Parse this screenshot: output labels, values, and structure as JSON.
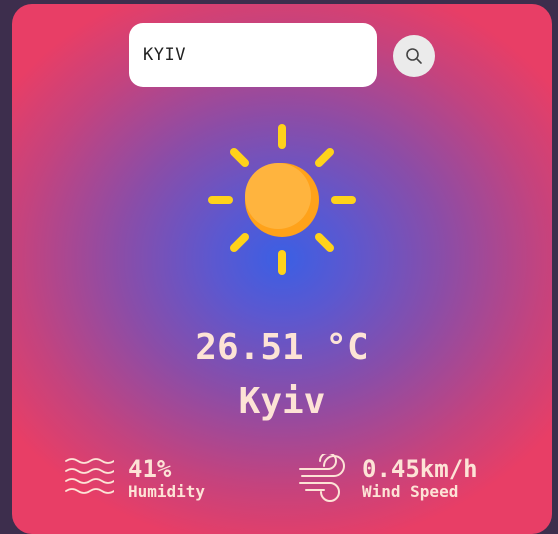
{
  "search": {
    "value": "KYIV",
    "icon": "search-icon"
  },
  "weather": {
    "icon": "sun-icon",
    "temperature": "26.51 °C",
    "city": "Kyiv"
  },
  "stats": {
    "humidity": {
      "icon": "waves-icon",
      "value": "41%",
      "label": "Humidity"
    },
    "wind": {
      "icon": "wind-icon",
      "value": "0.45km/h",
      "label": "Wind Speed"
    }
  },
  "colors": {
    "page_background": "#3d2e4d",
    "gradient_center": "#3b5fe4",
    "gradient_edge": "#e83e66",
    "text": "#fde3d6",
    "sun_body": "#ffb03b",
    "sun_rays": "#ffd21a"
  }
}
